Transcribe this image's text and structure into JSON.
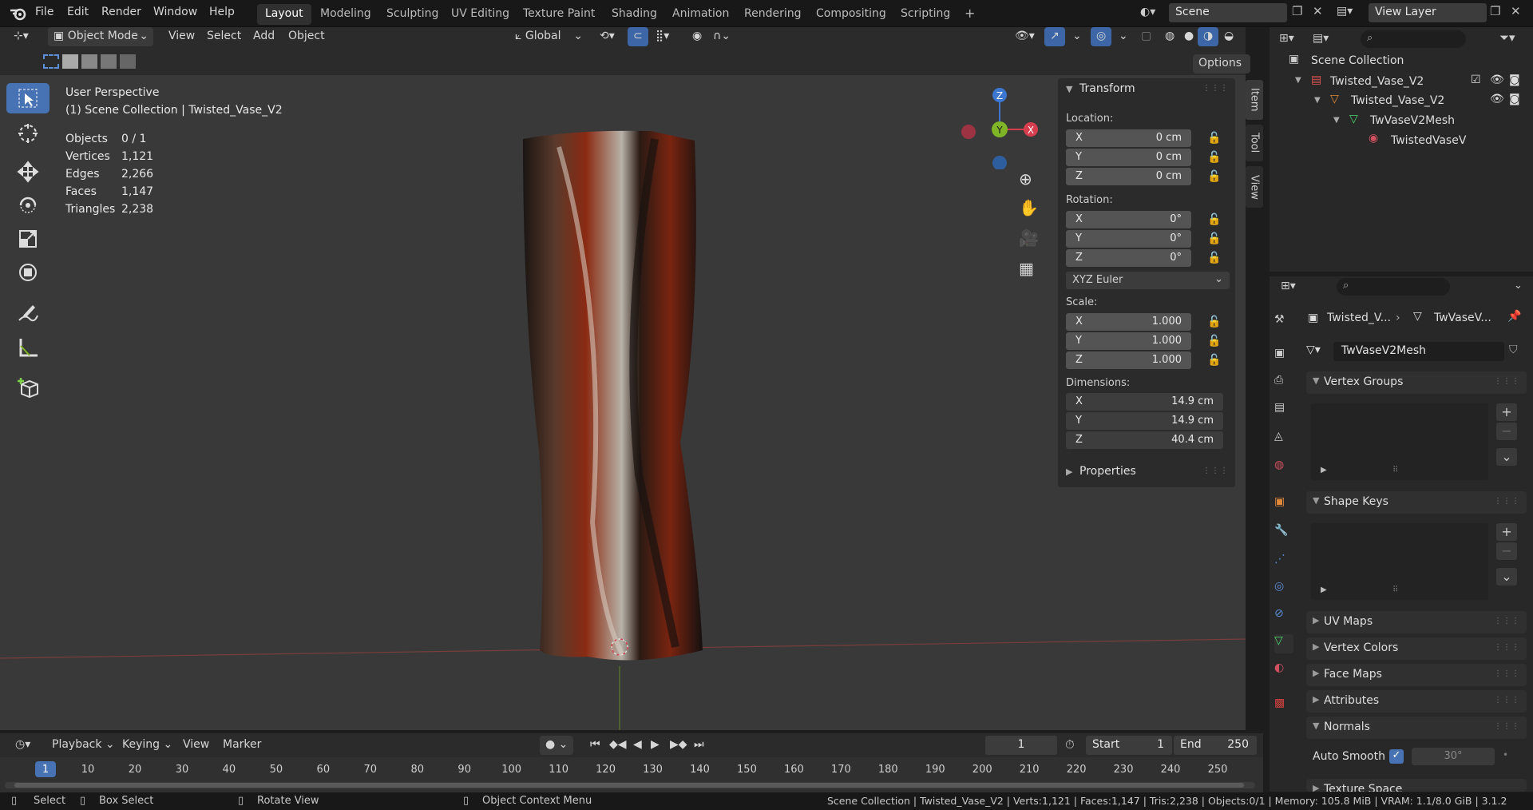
{
  "menus": [
    "File",
    "Edit",
    "Render",
    "Window",
    "Help"
  ],
  "workspaces": [
    "Layout",
    "Modeling",
    "Sculpting",
    "UV Editing",
    "Texture Paint",
    "Shading",
    "Animation",
    "Rendering",
    "Compositing",
    "Scripting"
  ],
  "active_workspace": "Layout",
  "add_workspace": "+",
  "scene_label": "Scene",
  "view_layer_label": "View Layer",
  "header": {
    "mode": "Object Mode",
    "menus": [
      "View",
      "Select",
      "Add",
      "Object"
    ],
    "transform_orientation": "Global",
    "options_label": "Options"
  },
  "viewport": {
    "perspective": "User Perspective",
    "collection_info": "(1) Scene Collection | Twisted_Vase_V2",
    "stats": [
      {
        "label": "Objects",
        "value": "0 / 1"
      },
      {
        "label": "Vertices",
        "value": "1,121"
      },
      {
        "label": "Edges",
        "value": "2,266"
      },
      {
        "label": "Faces",
        "value": "1,147"
      },
      {
        "label": "Triangles",
        "value": "2,238"
      }
    ],
    "gizmo": {
      "z": "Z",
      "y": "Y",
      "x": "X"
    }
  },
  "npanel": {
    "title": "Transform",
    "location_label": "Location:",
    "location": [
      {
        "axis": "X",
        "value": "0 cm"
      },
      {
        "axis": "Y",
        "value": "0 cm"
      },
      {
        "axis": "Z",
        "value": "0 cm"
      }
    ],
    "rotation_label": "Rotation:",
    "rotation": [
      {
        "axis": "X",
        "value": "0°"
      },
      {
        "axis": "Y",
        "value": "0°"
      },
      {
        "axis": "Z",
        "value": "0°"
      }
    ],
    "rotation_mode": "XYZ Euler",
    "scale_label": "Scale:",
    "scale": [
      {
        "axis": "X",
        "value": "1.000"
      },
      {
        "axis": "Y",
        "value": "1.000"
      },
      {
        "axis": "Z",
        "value": "1.000"
      }
    ],
    "dimensions_label": "Dimensions:",
    "dimensions": [
      {
        "axis": "X",
        "value": "14.9 cm"
      },
      {
        "axis": "Y",
        "value": "14.9 cm"
      },
      {
        "axis": "Z",
        "value": "40.4 cm"
      }
    ],
    "properties_label": "Properties",
    "tabs": [
      "Item",
      "Tool",
      "View"
    ]
  },
  "outliner": {
    "root": "Scene Collection",
    "collection": "Twisted_Vase_V2",
    "object": "Twisted_Vase_V2",
    "mesh": "TwVaseV2Mesh",
    "material": "TwistedVaseV"
  },
  "properties": {
    "breadcrumb_object": "Twisted_V...",
    "breadcrumb_mesh": "TwVaseV...",
    "mesh_name": "TwVaseV2Mesh",
    "sections": {
      "vertex_groups": "Vertex Groups",
      "shape_keys": "Shape Keys",
      "uv_maps": "UV Maps",
      "vertex_colors": "Vertex Colors",
      "face_maps": "Face Maps",
      "attributes": "Attributes",
      "normals": "Normals",
      "texture_space": "Texture Space"
    },
    "auto_smooth_label": "Auto Smooth",
    "auto_smooth_angle": "30°"
  },
  "timeline": {
    "menus": [
      "Playback",
      "Keying",
      "View",
      "Marker"
    ],
    "current_frame": "1",
    "start_label": "Start",
    "start": "1",
    "end_label": "End",
    "end": "250",
    "frames": [
      "1",
      "10",
      "20",
      "30",
      "40",
      "50",
      "60",
      "70",
      "80",
      "90",
      "100",
      "110",
      "120",
      "130",
      "140",
      "150",
      "160",
      "170",
      "180",
      "190",
      "200",
      "210",
      "220",
      "230",
      "240",
      "250"
    ]
  },
  "statusbar": {
    "select": "Select",
    "box_select": "Box Select",
    "rotate": "Rotate View",
    "context": "Object Context Menu",
    "info": "Scene Collection | Twisted_Vase_V2 | Verts:1,121 | Faces:1,147 | Tris:2,238 | Objects:0/1 | Memory: 105.8 MiB | VRAM: 1.1/8.0 GiB | 3.1.2"
  },
  "colors": {
    "accent": "#4772b3",
    "x_axis": "#d63d4e",
    "y_axis": "#7fb526",
    "z_axis": "#3b77cf",
    "vase_red": "#8a2a12"
  }
}
